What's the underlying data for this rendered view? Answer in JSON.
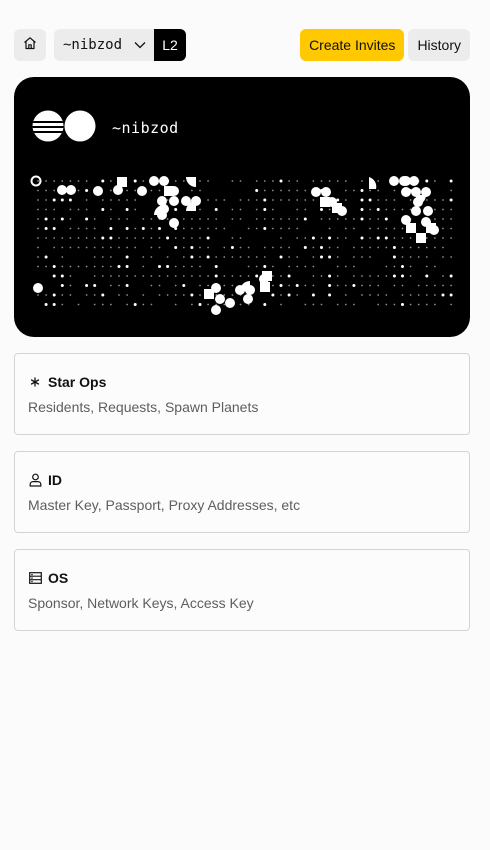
{
  "header": {
    "home_icon": "home-icon",
    "ship_name": "~nibzod",
    "layer_label": "L2",
    "create_invites_label": "Create Invites",
    "history_label": "History",
    "accent": "#ffc800"
  },
  "id_card": {
    "ship_name": "~nibzod",
    "background": "#000000"
  },
  "menu": [
    {
      "title": "Star Ops",
      "icon": "asterisk-icon",
      "description": "Residents, Requests, Spawn Planets"
    },
    {
      "title": "ID",
      "icon": "user-icon",
      "description": "Master Key, Passport, Proxy Addresses, etc"
    },
    {
      "title": "OS",
      "icon": "server-icon",
      "description": "Sponsor, Network Keys, Access Key"
    }
  ]
}
